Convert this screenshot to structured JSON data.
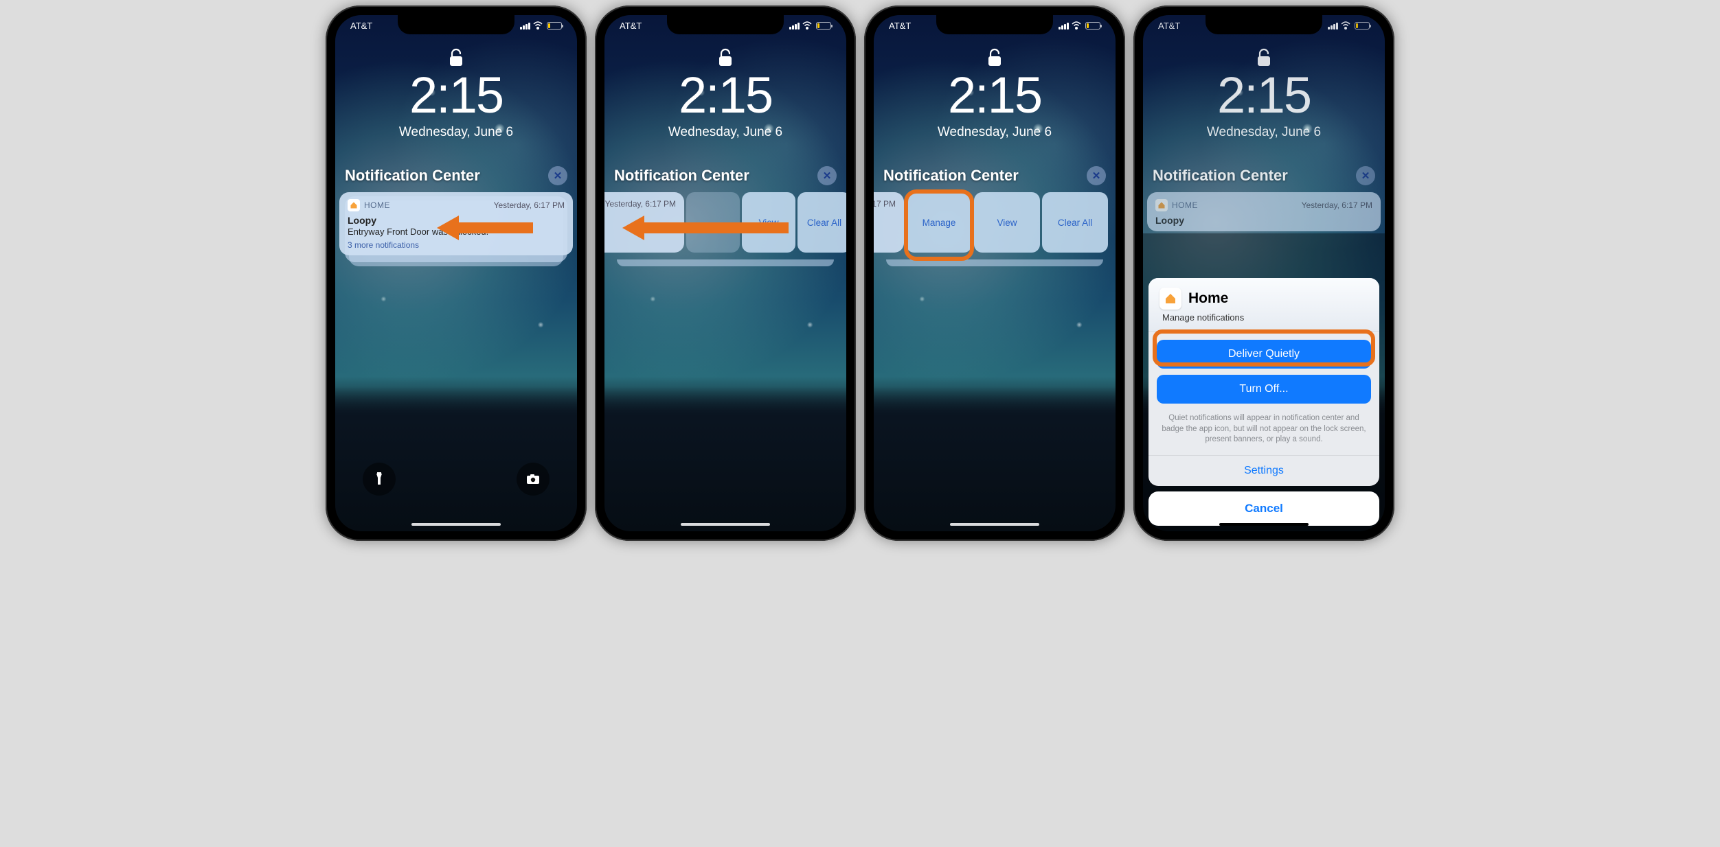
{
  "status": {
    "carrier": "AT&T"
  },
  "lockscreen": {
    "time": "2:15",
    "date": "Wednesday, June 6"
  },
  "nc": {
    "title": "Notification Center",
    "close": "✕"
  },
  "notif": {
    "app": "HOME",
    "time": "Yesterday, 6:17 PM",
    "title": "Loopy",
    "body": "Entryway Front Door was unlocked.",
    "more": "3 more notifications"
  },
  "partial": {
    "time": "Yesterday, 6:17 PM",
    "body_tail": "d."
  },
  "actions": {
    "manage": "Manage",
    "view": "View",
    "clear": "Clear All"
  },
  "partial3": {
    "time_tail": "17 PM"
  },
  "sheet": {
    "app": "Home",
    "subtitle": "Manage notifications",
    "deliver": "Deliver Quietly",
    "turn_off": "Turn Off...",
    "note": "Quiet notifications will appear in notification center and badge the app icon, but will not appear on the lock screen, present banners, or play a sound.",
    "settings": "Settings",
    "cancel": "Cancel"
  }
}
